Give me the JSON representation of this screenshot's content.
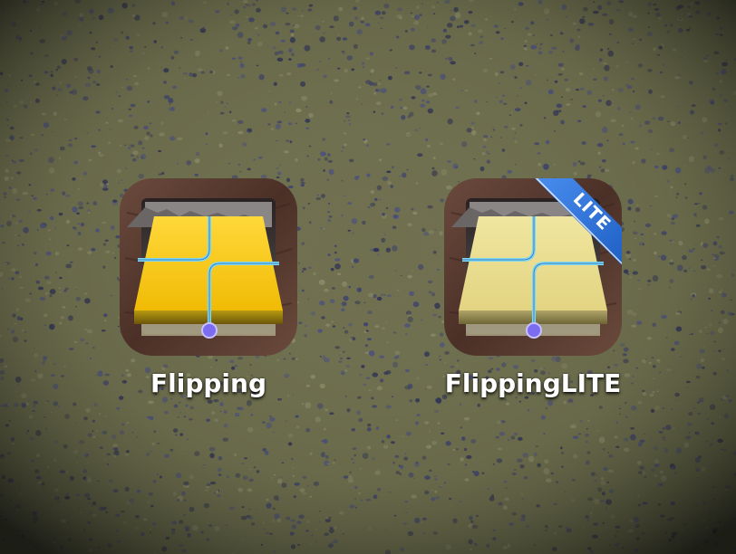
{
  "apps": [
    {
      "name": "Flipping",
      "tile_color": "#f5c414",
      "badge": ""
    },
    {
      "name": "FlippingLITE",
      "tile_color": "#e9dc8e",
      "badge": "LITE"
    }
  ],
  "colors": {
    "background": "#6f704f",
    "speckle": "#3b3f6e",
    "wood_frame": "#5a3d30",
    "route_line": "#7fd7f2",
    "route_dot": "#7b6cf0",
    "ribbon": "#2f74d8"
  },
  "icons": {
    "app_icon": "wooden-frame-with-flipping-tile",
    "badge": "lite-ribbon"
  }
}
